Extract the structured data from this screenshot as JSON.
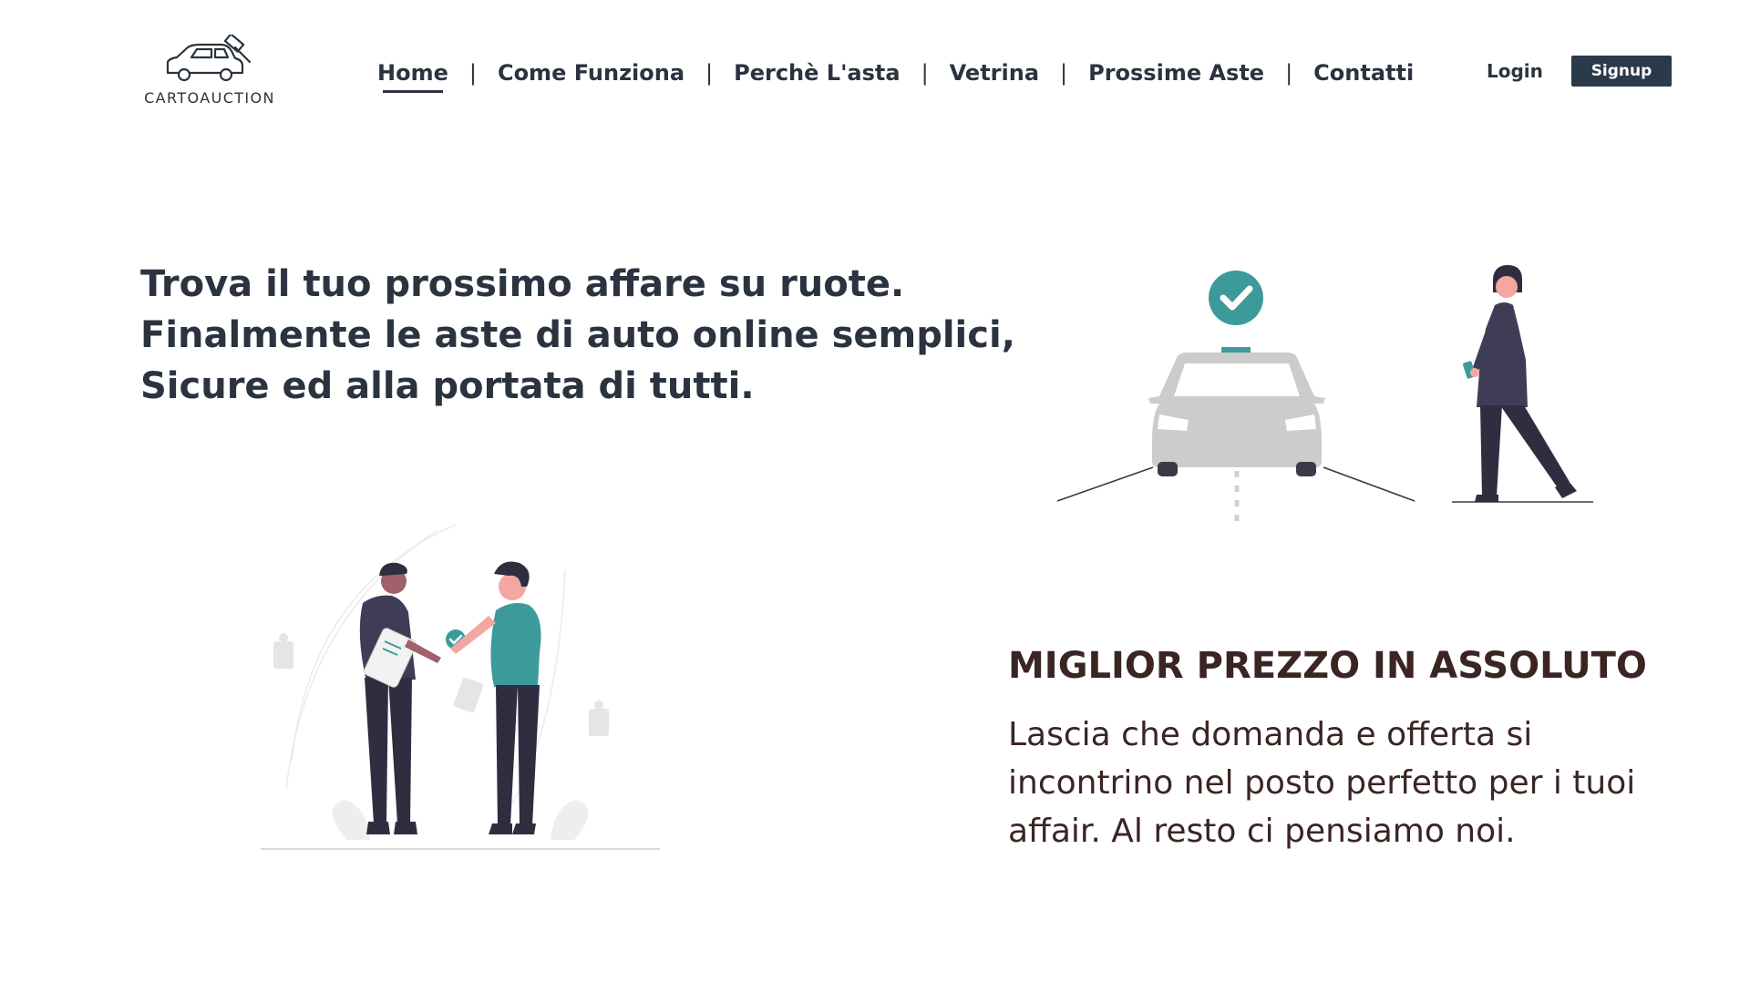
{
  "brand": {
    "name": "CARTOAUCTION",
    "logo_icon": "car-gavel-icon"
  },
  "nav": {
    "items": [
      {
        "label": "Home",
        "active": true
      },
      {
        "label": "Come Funziona"
      },
      {
        "label": "Perchè L'asta"
      },
      {
        "label": "Vetrina"
      },
      {
        "label": "Prossime Aste"
      },
      {
        "label": "Contatti"
      }
    ],
    "separator": "|"
  },
  "auth": {
    "login_label": "Login",
    "signup_label": "Signup"
  },
  "hero": {
    "lines": [
      "Trova il tuo prossimo affare su ruote.",
      "Finalmente le aste di auto online semplici,",
      "Sicure ed alla portata di tutti."
    ]
  },
  "feature": {
    "title": "MIGLIOR PREZZO IN ASSOLUTO",
    "desc_lines": [
      "Lascia che domanda e offerta si",
      "incontrino nel posto perfetto per i tuoi",
      "affair. Al resto ci pensiamo noi."
    ]
  },
  "colors": {
    "primary_text": "#2b3340",
    "accent_teal": "#3d9a9b",
    "feature_text": "#3a2523",
    "signup_bg": "#2b3a4a"
  }
}
